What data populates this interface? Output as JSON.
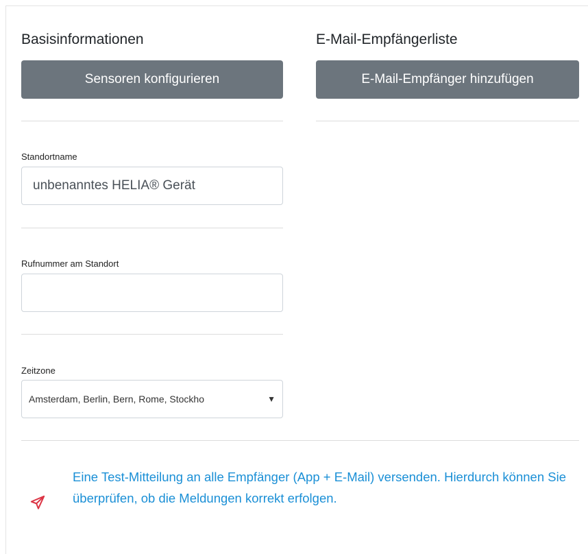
{
  "basic_info": {
    "title": "Basisinformationen",
    "configure_sensors_label": "Sensoren konfigurieren"
  },
  "email_list": {
    "title": "E-Mail-Empfängerliste",
    "add_recipient_label": "E-Mail-Empfänger hinzufügen"
  },
  "fields": {
    "location_name": {
      "label": "Standortname",
      "value": "unbenanntes HELIA® Gerät"
    },
    "phone": {
      "label": "Rufnummer am Standort",
      "value": ""
    },
    "timezone": {
      "label": "Zeitzone",
      "selected": "Amsterdam, Berlin, Bern, Rome, Stockho"
    }
  },
  "test_notification": {
    "text": "Eine Test-Mitteilung an alle Empfänger (App + E-Mail) versenden. Hierdurch können Sie überprüfen, ob die Meldungen korrekt erfolgen.",
    "icon": "paper-plane-icon",
    "icon_color": "#dc3545",
    "link_color": "#1a8fd6"
  },
  "colors": {
    "button_bg": "#6c757d",
    "button_text": "#ffffff"
  }
}
